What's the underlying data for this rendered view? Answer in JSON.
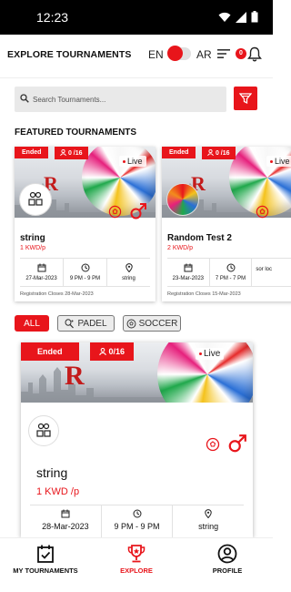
{
  "status_bar": {
    "time": "12:23"
  },
  "header": {
    "title": "EXPLORE TOURNAMENTS",
    "lang_en": "EN",
    "lang_ar": "AR",
    "notification_count": "0"
  },
  "search": {
    "placeholder": "Search Tournaments..."
  },
  "featured": {
    "title": "FEATURED TOURNAMENTS",
    "cards": [
      {
        "status": "Ended",
        "participants": "0 /16",
        "live": "Live",
        "name": "string",
        "price": "1 KWD/p",
        "date": "27-Mar-2023",
        "time": "9 PM - 9 PM",
        "location": "string",
        "registration": "Registration Closes 28-Mar-2023"
      },
      {
        "status": "Ended",
        "participants": "0 /16",
        "live": "Live",
        "name": "Random Test 2",
        "price": "2 KWD/p",
        "date": "23-Mar-2023",
        "time": "7 PM - 7 PM",
        "location": "sor loc",
        "registration": "Registration Closes 15-Mar-2023"
      }
    ]
  },
  "filters": {
    "all": "ALL",
    "padel": "PADEL",
    "soccer": "SOCCER"
  },
  "tournaments": [
    {
      "status": "Ended",
      "participants": "0/16",
      "live": "Live",
      "name": "string",
      "price": "1 KWD /p",
      "date": "28-Mar-2023",
      "time": "9 PM - 9 PM",
      "location": "string"
    }
  ],
  "bottom_nav": {
    "my_tournaments": "MY TOURNAMENTS",
    "explore": "EXPLORE",
    "profile": "PROFILE"
  },
  "colors": {
    "accent": "#e8151b",
    "text": "#111111"
  },
  "icons": [
    "wifi-icon",
    "signal-icon",
    "battery-icon",
    "menu-icon",
    "bell-icon",
    "search-icon",
    "filter-icon",
    "soccer-ball-icon",
    "male-icon",
    "calendar-icon",
    "clock-icon",
    "location-pin-icon",
    "padel-icon",
    "trophy-icon",
    "profile-icon",
    "calendar-check-icon"
  ]
}
